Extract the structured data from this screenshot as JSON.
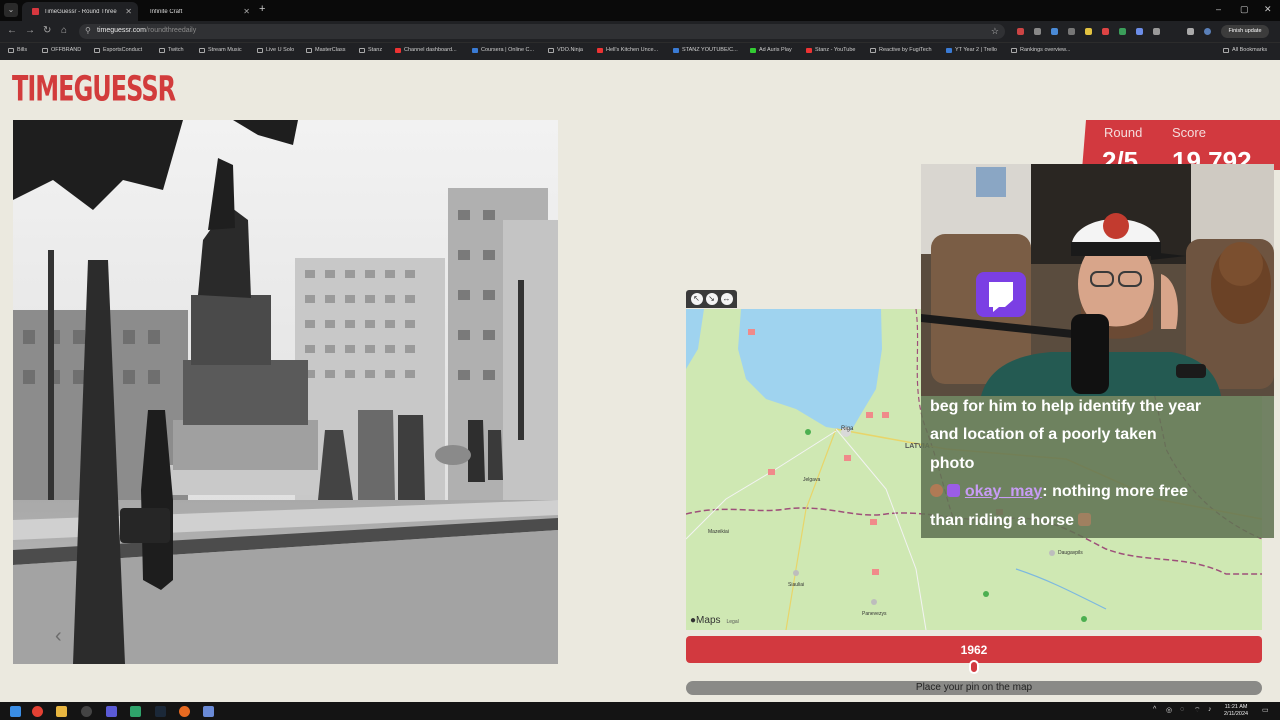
{
  "browser": {
    "tabs": [
      {
        "title": "TimeGuessr - Round Three",
        "active": true
      },
      {
        "title": "Infinite Craft",
        "active": false
      }
    ],
    "url_host": "timeguessr.com",
    "url_path": "/roundthreedaily",
    "finish_update": "Finish update",
    "bookmarks": [
      "Bills",
      "OFFBRAND",
      "EsportsConduct",
      "Twitch",
      "Stream Music",
      "Live U Solo",
      "MasterClass",
      "Stanz",
      "Channel dashboard...",
      "Coursera | Online C...",
      "VDO.Ninja",
      "Hell's Kitchen Unce...",
      "STANZ YOUTUBE/C...",
      "Ad Auris Play",
      "Stanz - YouTube",
      "Reactive by FugiTech",
      "YT Year 2 | Trello",
      "Rankings overview...",
      "All Bookmarks"
    ]
  },
  "game": {
    "logo": "TIMEGUESSR",
    "round_label": "Round",
    "score_label": "Score",
    "round_value": "2/5",
    "score_value": "19,792",
    "year_value": "1962",
    "pin_button": "Place your pin on the map",
    "map_credit": "Maps",
    "map_legal": "Legal",
    "map_labels": {
      "city": "Riga",
      "country": "LATVIA",
      "town1": "Jelgava",
      "town2": "Daugavpils",
      "town3": "Siauliai",
      "town4": "Panevezys",
      "town5": "Mazeikiai"
    }
  },
  "stream": {
    "chat": {
      "line1": "beg for him to help identify the year",
      "line2": "and location of a poorly taken",
      "line3": "photo",
      "user": "okay_may",
      "message1": ": nothing more free",
      "message2": "than riding a horse"
    }
  },
  "taskbar": {
    "time": "11:21 AM",
    "date": "2/11/2024"
  },
  "colors": {
    "accent": "#d2393f",
    "page_bg": "#ebe9df",
    "map_water": "#9fd3ef",
    "map_land": "#cfe8b3"
  }
}
